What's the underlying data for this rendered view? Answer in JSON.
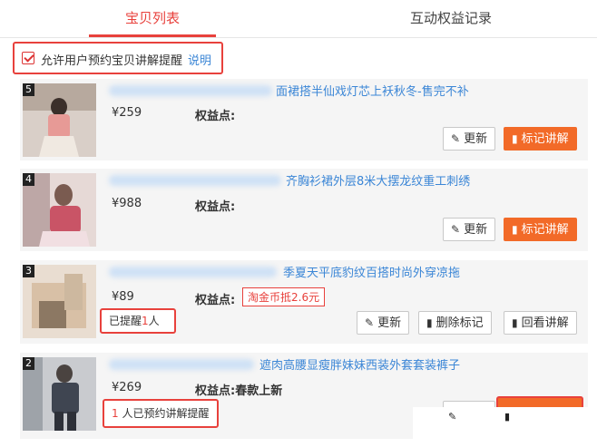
{
  "tabs": [
    {
      "label": "宝贝列表",
      "active": true
    },
    {
      "label": "互动权益记录",
      "active": false
    }
  ],
  "allow_reminder": {
    "checked": true,
    "label": "允许用户预约宝贝讲解提醒",
    "link": "说明"
  },
  "items": [
    {
      "rank": "5",
      "title": "面裙搭半仙戏灯芯上袄秋冬-售完不补",
      "price": "¥259",
      "equity_label": "权益点:",
      "equity_value": "",
      "buttons": {
        "update": "更新",
        "mark": "标记讲解"
      }
    },
    {
      "rank": "4",
      "title": "齐胸衫裙外层8米大摆龙纹重工刺绣",
      "price": "¥988",
      "equity_label": "权益点:",
      "equity_value": "",
      "buttons": {
        "update": "更新",
        "mark": "标记讲解"
      }
    },
    {
      "rank": "3",
      "title": "季夏天平底豹纹百搭时尚外穿凉拖",
      "price": "¥89",
      "equity_label": "权益点:",
      "equity_badge": "淘金币抵2.6元",
      "reminder": {
        "prefix": "已提醒",
        "count": "1",
        "suffix": "人"
      },
      "buttons": {
        "update": "更新",
        "delete_mark": "删除标记",
        "replay": "回看讲解"
      }
    },
    {
      "rank": "2",
      "title": "遮肉高腰显瘦胖妹妹西装外套套装裤子",
      "price": "¥269",
      "equity_label": "权益点:",
      "equity_value": "春款上新",
      "reminder": {
        "count": "1",
        "suffix": " 人已预约讲解提醒"
      }
    }
  ],
  "colors": {
    "accent": "#e8413c",
    "link": "#3b86d6",
    "orange_button": "#f26a28",
    "card_bg": "#f5f5f5"
  },
  "icons": {
    "update": "edit-icon",
    "mark": "bookmark-icon",
    "delete_mark": "bookmark-icon",
    "replay": "bookmark-icon"
  }
}
